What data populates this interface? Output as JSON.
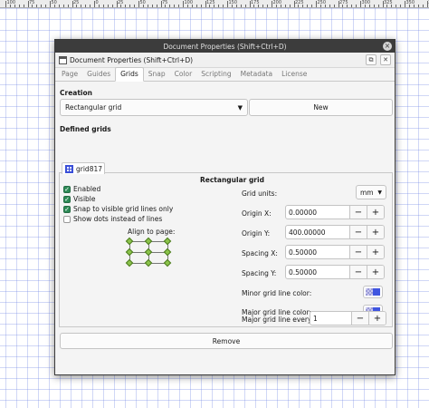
{
  "ruler": {
    "labels": [
      "100",
      "75",
      "50",
      "25",
      "0",
      "25",
      "50",
      "75",
      "100",
      "125",
      "150",
      "175",
      "200",
      "225",
      "250",
      "275",
      "300",
      "325",
      "350",
      "375"
    ]
  },
  "window": {
    "title": "Document Properties (Shift+Ctrl+D)",
    "close_glyph": "×"
  },
  "panel": {
    "title": "Document Properties (Shift+Ctrl+D)",
    "btn1": "⧉",
    "btn2": "✕"
  },
  "tabs": [
    "Page",
    "Guides",
    "Grids",
    "Snap",
    "Color",
    "Scripting",
    "Metadata",
    "License"
  ],
  "active_tab": "Grids",
  "creation": {
    "label": "Creation",
    "grid_type": "Rectangular grid",
    "new_label": "New"
  },
  "defined": {
    "label": "Defined grids",
    "grid_name": "grid817",
    "heading": "Rectangular grid"
  },
  "options": [
    {
      "label": "Enabled",
      "checked": true
    },
    {
      "label": "Visible",
      "checked": true
    },
    {
      "label": "Snap to visible grid lines only",
      "checked": true
    },
    {
      "label": "Show dots instead of lines",
      "checked": false
    }
  ],
  "align_label": "Align to page:",
  "units": {
    "label": "Grid units:",
    "value": "mm"
  },
  "fields": {
    "origin_x": {
      "label": "Origin X:",
      "value": "0.00000"
    },
    "origin_y": {
      "label": "Origin Y:",
      "value": "400.00000"
    },
    "spacing_x": {
      "label": "Spacing X:",
      "value": "0.50000"
    },
    "spacing_y": {
      "label": "Spacing Y:",
      "value": "0.50000"
    },
    "major_every": {
      "label": "Major grid line every:",
      "value": "1"
    }
  },
  "spin_minus": "−",
  "spin_plus": "+",
  "minor_color_label": "Minor grid line color:",
  "major_color_label": "Major grid line color:",
  "remove_label": "Remove",
  "colors": {
    "accent": "#3f55e0",
    "check": "#2e8b57",
    "handle": "#8bc34a"
  }
}
